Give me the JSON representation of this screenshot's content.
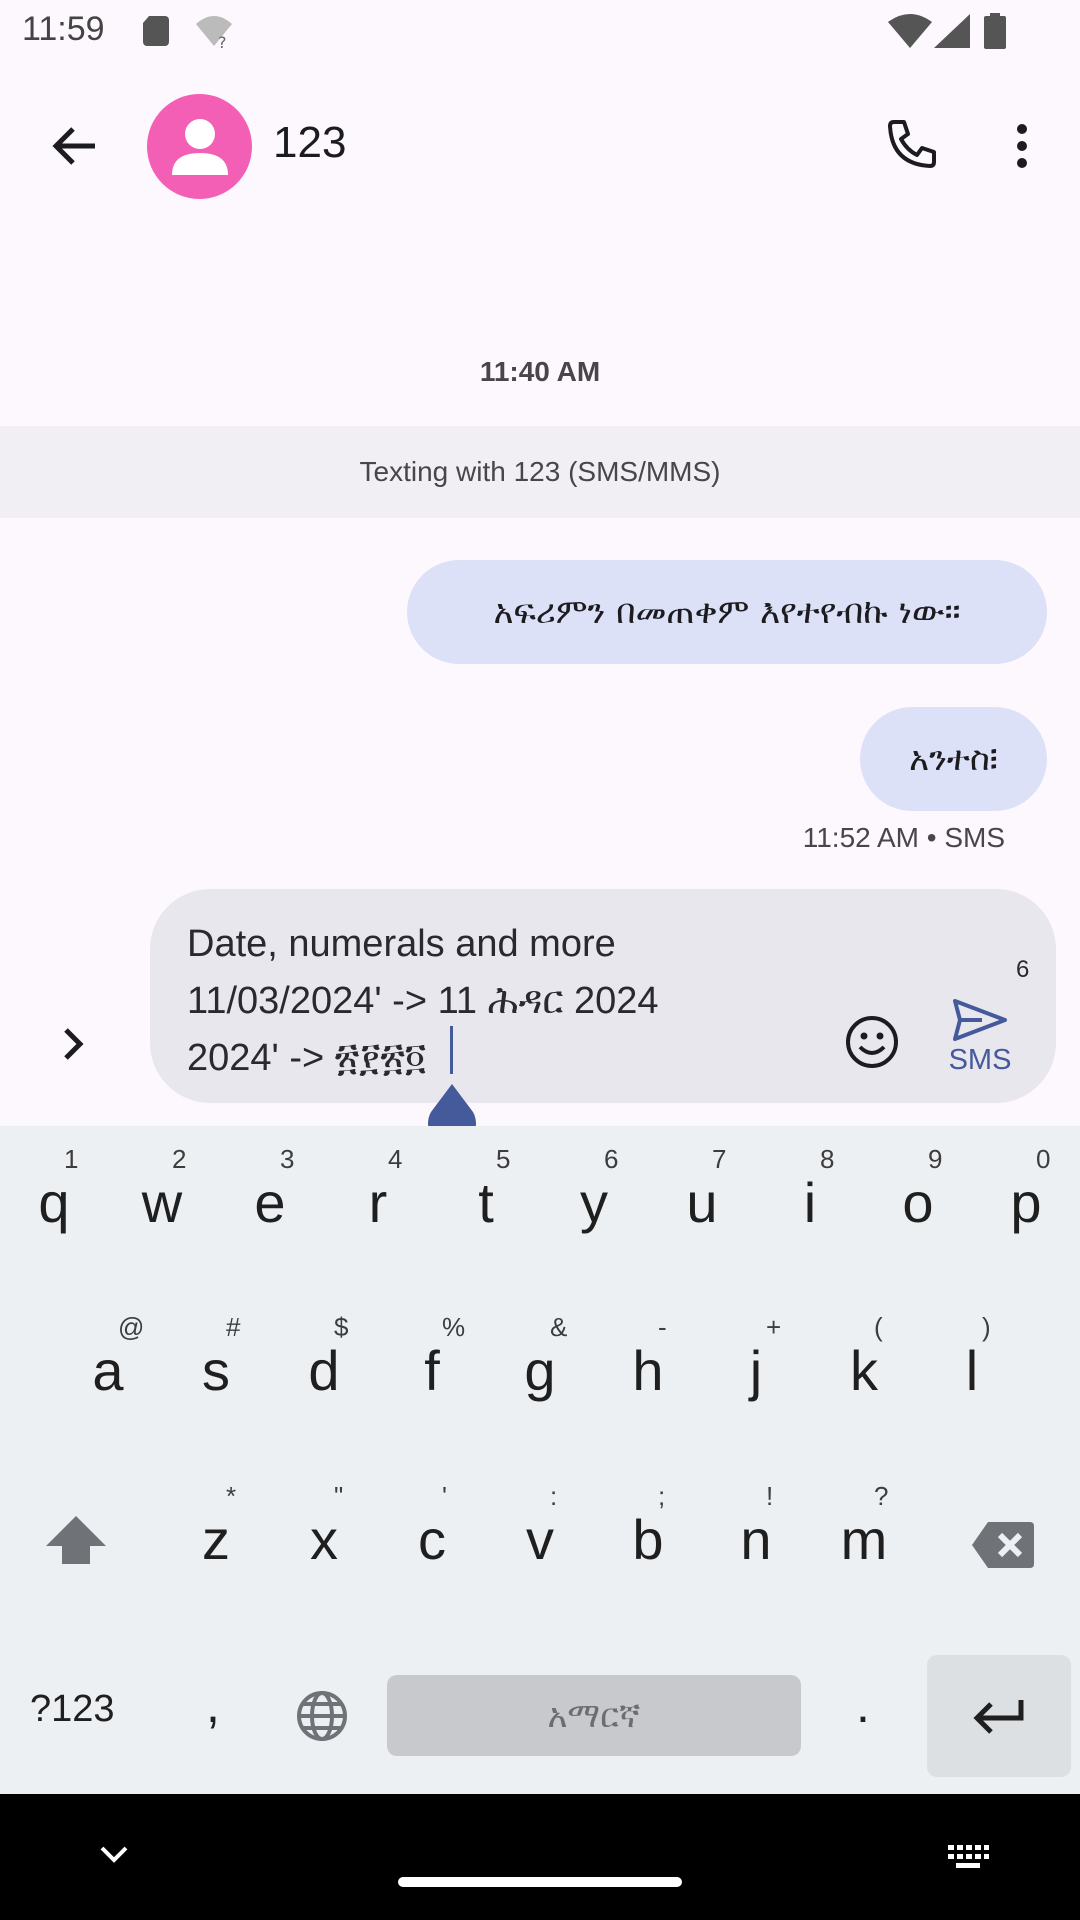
{
  "status_bar": {
    "time": "11:59"
  },
  "header": {
    "contact_name": "123"
  },
  "conversation": {
    "date_separator": "11:40 AM",
    "texting_banner": "Texting with 123 (SMS/MMS)",
    "messages": [
      {
        "text": "አፍሪምን በመጠቀም እየተየብኩ ነው።"
      },
      {
        "text": "አንተስ፧"
      }
    ],
    "last_meta": "11:52 AM • SMS"
  },
  "compose": {
    "text": "Date, numerals and more\n11/03/2024' -> 11 ሕዳር 2024\n2024' -> ፳፻፳፬",
    "char_count": "6",
    "send_label": "SMS"
  },
  "keyboard": {
    "row1": [
      {
        "key": "q",
        "hint": "1"
      },
      {
        "key": "w",
        "hint": "2"
      },
      {
        "key": "e",
        "hint": "3"
      },
      {
        "key": "r",
        "hint": "4"
      },
      {
        "key": "t",
        "hint": "5"
      },
      {
        "key": "y",
        "hint": "6"
      },
      {
        "key": "u",
        "hint": "7"
      },
      {
        "key": "i",
        "hint": "8"
      },
      {
        "key": "o",
        "hint": "9"
      },
      {
        "key": "p",
        "hint": "0"
      }
    ],
    "row2": [
      {
        "key": "a",
        "hint": "@"
      },
      {
        "key": "s",
        "hint": "#"
      },
      {
        "key": "d",
        "hint": "$"
      },
      {
        "key": "f",
        "hint": "%"
      },
      {
        "key": "g",
        "hint": "&"
      },
      {
        "key": "h",
        "hint": "-"
      },
      {
        "key": "j",
        "hint": "+"
      },
      {
        "key": "k",
        "hint": "("
      },
      {
        "key": "l",
        "hint": ")"
      }
    ],
    "row3": [
      {
        "key": "z",
        "hint": "*"
      },
      {
        "key": "x",
        "hint": "\""
      },
      {
        "key": "c",
        "hint": "'"
      },
      {
        "key": "v",
        "hint": ":"
      },
      {
        "key": "b",
        "hint": ";"
      },
      {
        "key": "n",
        "hint": "!"
      },
      {
        "key": "m",
        "hint": "?"
      }
    ],
    "symbols_label": "?123",
    "comma": ",",
    "space_label": "አማርኛ",
    "period": "."
  },
  "colors": {
    "avatar": "#f35fb5",
    "bubble": "#dde1f7",
    "accent": "#455a9b"
  }
}
